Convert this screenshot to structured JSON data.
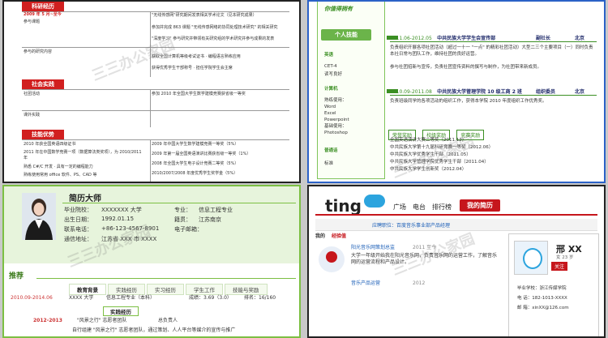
{
  "watermark": "三三办公家园",
  "panel_a": {
    "row_date": "2009 年 5 月~至今",
    "lbl_unit": "参与课题",
    "lbl_work": "参与的研究内容",
    "sec_social": "社会实践",
    "lbl_society": "社团活动",
    "lbl_practice": "课外实践",
    "sec_skills": "技能优势",
    "t1": "\"无线传感网\"研究期间发表相关学术论文（见本研究成果）",
    "t2": "参加并完成 863 课题 \"无线传感网络的协同处理技术研究\" 的相关研究",
    "t3": "\"深度学习\" 参与研究并带领有关研究组的学术研究并参与成果的发表",
    "t4": "获取全国计算机等级考试证书 · 编程语言熟练应用",
    "t5": "获得优秀学生干部称号 · 担任学院学生会主席",
    "t6": "参加 2010 年全国大学生数学建模竞赛获省级一等奖",
    "k1": "2010 年获全国英语四级证书",
    "k2": "2011 年在中国数学竞赛一项（数据算法类奖项），为 2010/2011 年",
    "k3": "熟悉 C#/C 开发 · 具有一定的编程能力",
    "k4": "熟练使用常用 office 软件、PS、CAD 等",
    "r1": "2009 年中国大学生数学建模竞赛一等奖（5%）",
    "r2": "2009 年第一届全国英语演讲比赛获省级一等奖（1%）",
    "r3": "2008 年全国大学生电子设计竞赛二等奖（5%）",
    "r4": "2010/2007/2008 年度优秀学生奖学金（5%）"
  },
  "panel_b": {
    "slogan": "你值得拥有",
    "skill_btn": "个人技能",
    "side_lang": "英语",
    "side_cet": "CET-4",
    "side_read": "读写良好",
    "side_comp": "计算机",
    "side_soft": "熟练使用：",
    "side_word": "Word",
    "side_excel": "Excel",
    "side_ppt": "Powerpoint",
    "side_basic": "基础使用：",
    "side_ps": "Photoshop",
    "side_music": "普通话",
    "side_std": "标准",
    "h1_date": "2011.06-2012.05",
    "h1_org": "中共民族大学学生会宣传部",
    "h1_role": "副社长",
    "h1_city": "北京",
    "d1": "负责组织开展各项社团活动（超过一十一 \"一点\" 的精彩社团活动）大型二三个主要项目（一）同时负责本社日常与团队工作，维持社团的良好运营。",
    "d2": "参与社团招新与宣传，负责社团宣传资料的撰写与制作，为社团带来新成员。",
    "h2_date": "2010.09-2011.08",
    "h2_org": "中共民族大学管理学院 10 级工商 2 班",
    "h2_role": "组织委员",
    "h2_city": "北京",
    "d3": "负责班级同学的各项活动的组织工作，获得本学院 2010 年度组织工作优秀奖。",
    "tab1": "荣誉奖励",
    "tab2": "校级奖励",
    "tab3": "竞赛奖励",
    "a1": "全国英语演讲大赛二等奖（2011.12）",
    "a2": "中共民族大学第十九届科研竞赛一等奖（2012.06）",
    "a3": "中共民族大学优秀学生干部（2011.05）",
    "a4": "中共民族大学管理学院优秀学生干部（2011.04）",
    "a5": "中共民族大学学生创新奖（2012.04）"
  },
  "panel_c": {
    "name": "简历大师",
    "school_lbl": "毕业院校：",
    "school_val": "XXXXXXX 大学",
    "major_lbl": "专业：",
    "major_val": "信息工程专业",
    "birth_lbl": "出生日期：",
    "birth_val": "1992.01.15",
    "home_lbl": "籍贯：",
    "home_val": "江苏南京",
    "phone_lbl": "联系电话：",
    "phone_val": "+86-123-4567-8901",
    "email_lbl": "电子邮箱：",
    "email_val": "",
    "addr_lbl": "通信地址：",
    "addr_val": "江苏省 XXX 市 XXXX",
    "rec": "推荐",
    "tabs": [
      "教育背景",
      "实践经历",
      "实习经历",
      "学生工作",
      "技能与奖励"
    ],
    "edu_date": "2010.09-2014.06",
    "edu_school": "XXXX 大学",
    "edu_major": "信息工程专业（本科）",
    "edu_gpa": "成绩：3.69（3.0）",
    "edu_rank": "排名：16/160",
    "chip": "实践经历",
    "p_date": "2012-2013",
    "p_title": "\"风景之行\" 志愿者团队",
    "p_role": "总负责人",
    "p_desc": "自行组建 \"风景之行\" 志愿者团队，通过策划、人人平台等媒介的宣传与推广"
  },
  "panel_d": {
    "logo": "ting",
    "nav": [
      "广场",
      "电台",
      "排行榜"
    ],
    "mine": "我的简历",
    "bar_text": "应聘职位：百度音乐事业部产品经理",
    "my": "我的",
    "myexp": "经验值",
    "f1_title": "阳光音乐网策划总监",
    "f1_date": "2011 至今",
    "f1_desc": "大学一年级开始我在阳光音乐网，负责音乐网的运营工作，了解音乐网的运营流程和产品设计。",
    "f2_title": "音乐产品运营",
    "f2_date": "2012",
    "card_name": "邢 XX",
    "card_sub": "女 23 岁",
    "follow": "关注",
    "c_school": "毕业学校：浙江传媒学院",
    "c_phone": "电  话：182-1013-XXXX",
    "c_mail": "邮  箱：xinXX@126.com"
  }
}
